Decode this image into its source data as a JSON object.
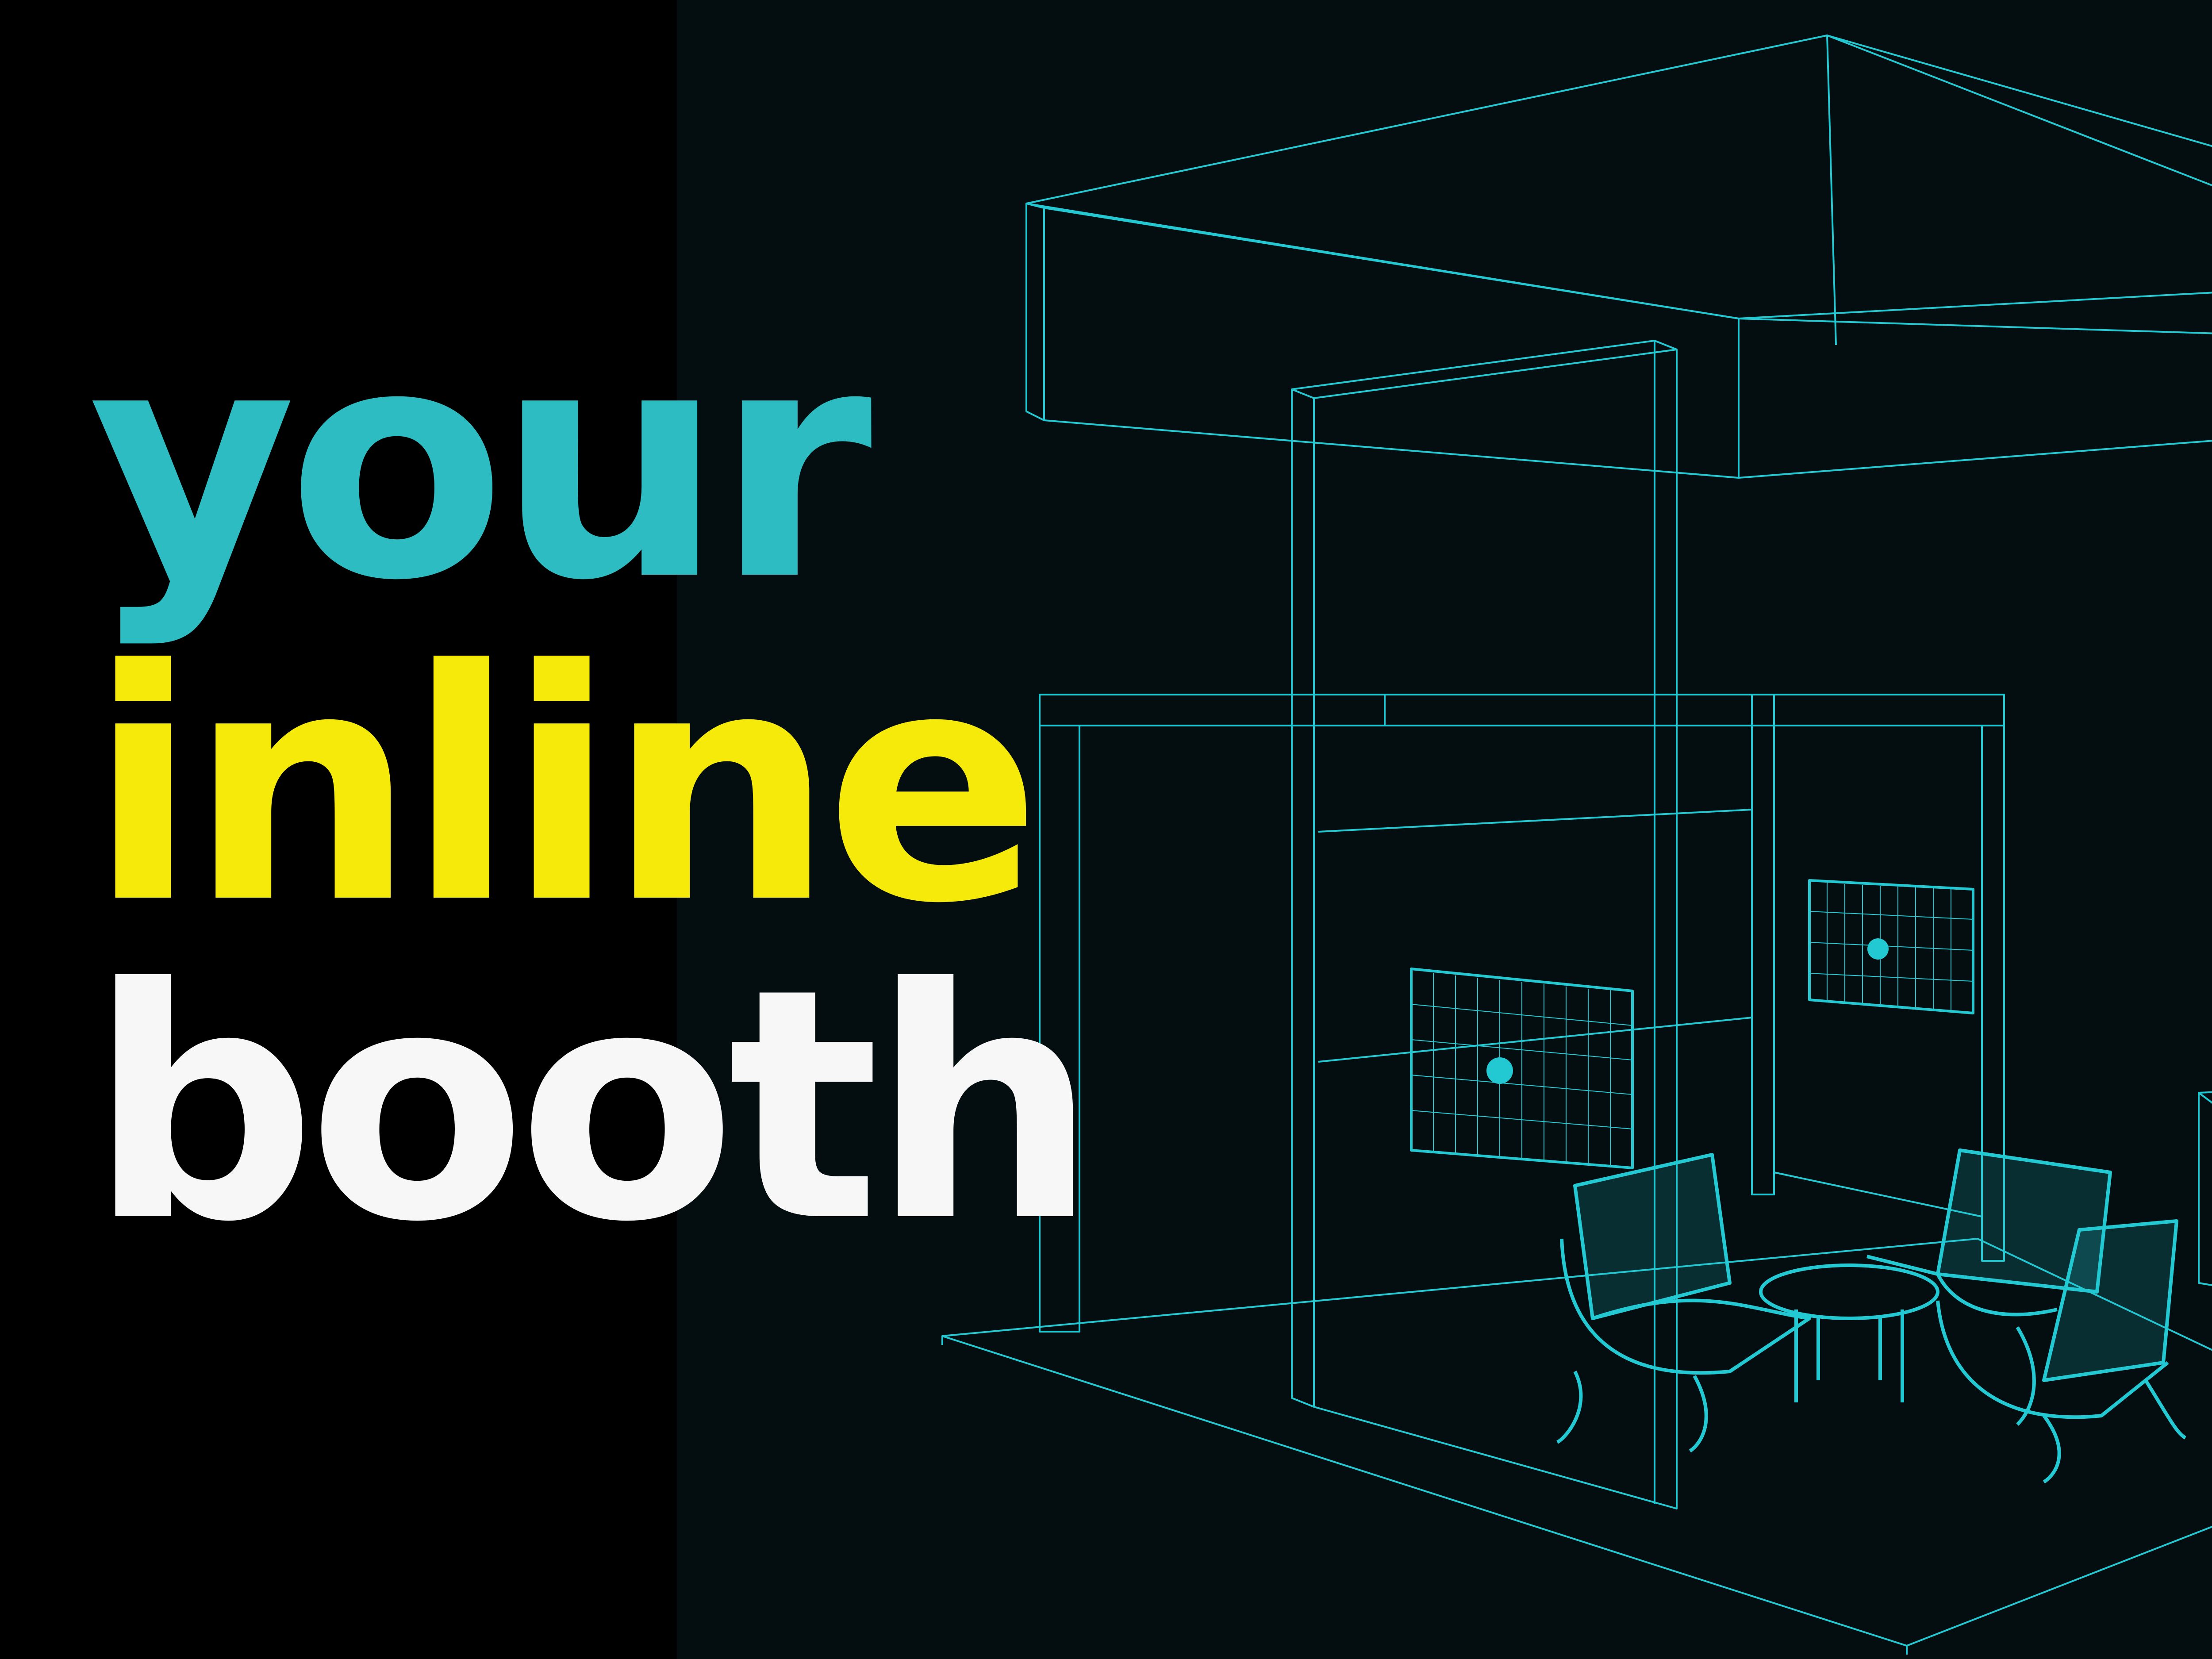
{
  "headline": {
    "line1": "your",
    "line2": "inline",
    "line3": "booth"
  },
  "colors": {
    "background_left": "#000000",
    "background_right": "#040d0f",
    "line1": "#2dbcc2",
    "line2": "#f6ea0b",
    "line3": "#f7f7f7",
    "wireframe": "#22c9d2"
  },
  "illustration": {
    "subject": "wireframe-inline-trade-show-booth",
    "icon": "booth-wireframe-icon"
  }
}
